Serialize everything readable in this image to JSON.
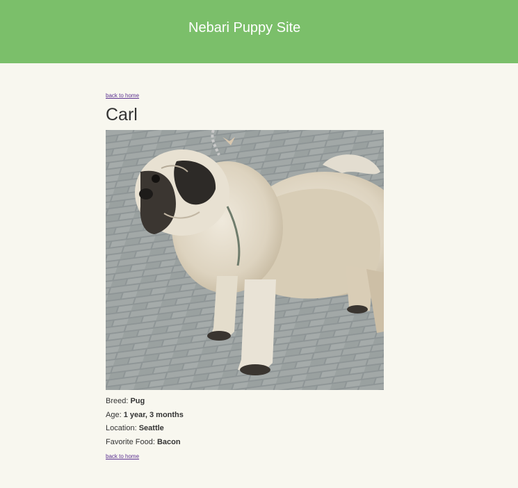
{
  "header": {
    "title": "Nebari Puppy Site",
    "background_color": "#7bbf6a"
  },
  "nav": {
    "back_link_top": "back to home",
    "back_link_bottom": "back to home"
  },
  "dog": {
    "name": "Carl",
    "photo": "pug-photo",
    "details": [
      {
        "label": "Breed:",
        "value": "Pug"
      },
      {
        "label": "Age:",
        "value": "1 year, 3 months"
      },
      {
        "label": "Location:",
        "value": "Seattle"
      },
      {
        "label": "Favorite Food:",
        "value": "Bacon"
      }
    ]
  }
}
